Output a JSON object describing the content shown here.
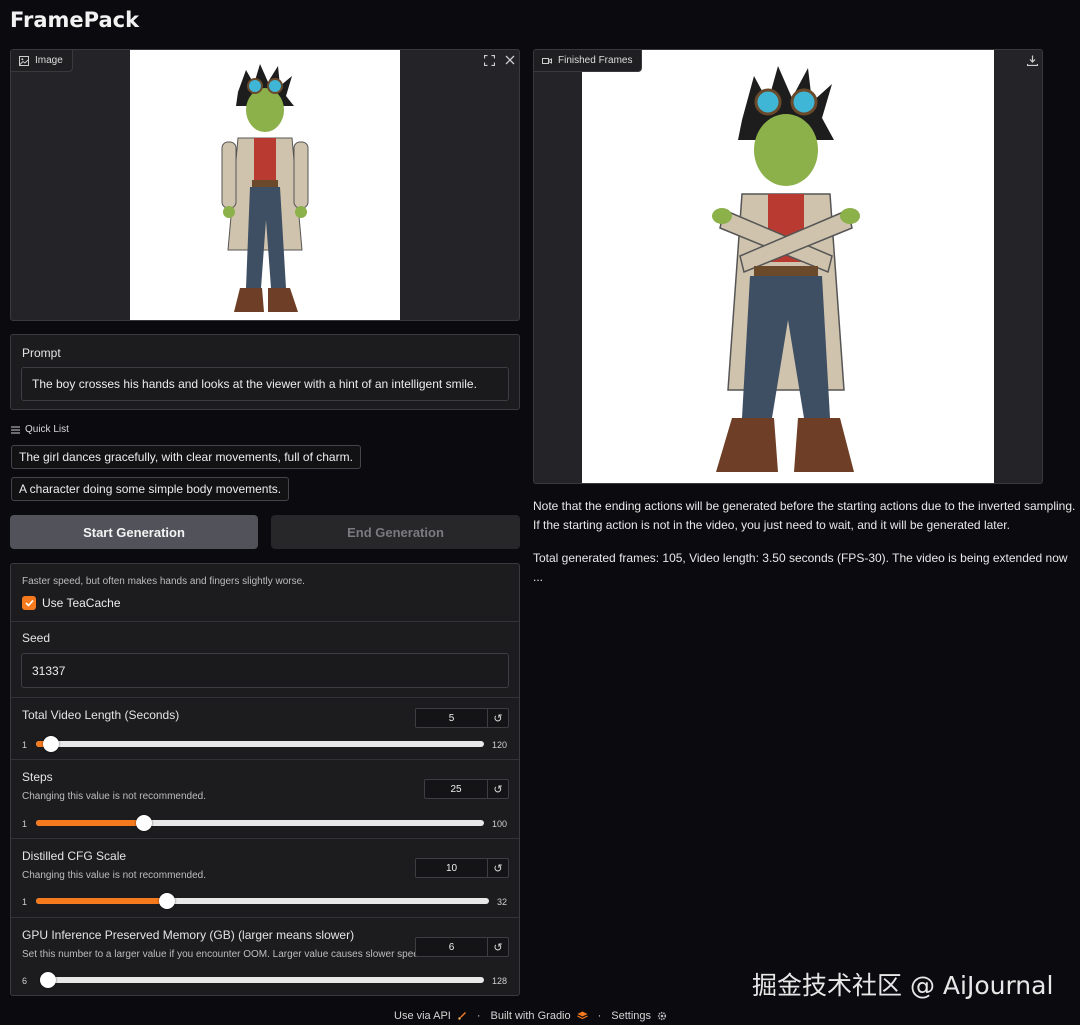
{
  "app": {
    "title": "FramePack"
  },
  "image_panel": {
    "tag_label": "Image"
  },
  "prompt": {
    "label": "Prompt",
    "value": "The boy crosses his hands and looks at the viewer with a hint of an intelligent smile."
  },
  "quick_list": {
    "label": "Quick List",
    "items": [
      "The girl dances gracefully, with clear movements, full of charm.",
      "A character doing some simple body movements."
    ]
  },
  "buttons": {
    "start": "Start Generation",
    "end": "End Generation"
  },
  "settings": {
    "teacache_hint": "Faster speed, but often makes hands and fingers slightly worse.",
    "teacache_label": "Use TeaCache",
    "teacache_checked": true,
    "seed": {
      "label": "Seed",
      "value": "31337"
    },
    "sliders": [
      {
        "label": "Total Video Length (Seconds)",
        "hint": "",
        "value": "5",
        "min": "1",
        "max": "120",
        "fraction": 0.034
      },
      {
        "label": "Steps",
        "hint": "Changing this value is not recommended.",
        "value": "25",
        "min": "1",
        "max": "100",
        "fraction": 0.242
      },
      {
        "label": "Distilled CFG Scale",
        "hint": "Changing this value is not recommended.",
        "value": "10",
        "min": "1",
        "max": "32",
        "fraction": 0.29
      },
      {
        "label": "GPU Inference Preserved Memory (GB) (larger means slower)",
        "hint": "Set this number to a larger value if you encounter OOM. Larger value causes slower speed.",
        "value": "6",
        "min": "6",
        "max": "128",
        "fraction": 0.0
      }
    ],
    "reset_icon": "↺"
  },
  "output": {
    "tag_label": "Finished Frames",
    "note_line1": "Note that the ending actions will be generated before the starting actions due to the inverted sampling.",
    "note_line2": "If the starting action is not in the video, you just need to wait, and it will be generated later.",
    "progress_text": "Total generated frames: 105, Video length: 3.50 seconds (FPS-30). The video is being extended now ..."
  },
  "footer": {
    "api": "Use via API",
    "built": "Built with Gradio",
    "settings": "Settings",
    "sep": "·"
  },
  "watermark": "掘金技术社区 @ AiJournal",
  "colors": {
    "accent": "#f57a1e",
    "background": "#0b0b0f",
    "panel": "#1c1c1f",
    "start_button": "#52525b",
    "end_button": "#27272a"
  }
}
